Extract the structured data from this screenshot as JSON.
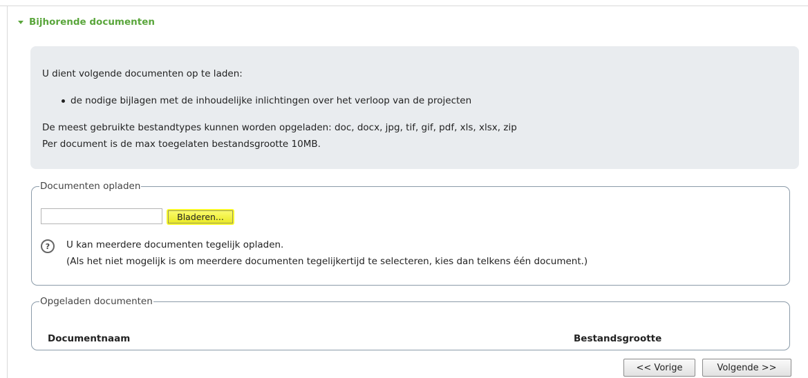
{
  "section": {
    "title": "Bijhorende documenten"
  },
  "info": {
    "intro": "U dient volgende documenten op te laden:",
    "items": [
      "de nodige bijlagen met de inhoudelijke inlichtingen over het verloop van de projecten"
    ],
    "types": "De meest gebruikte bestandtypes kunnen worden opgeladen: doc, docx, jpg, tif, gif, pdf, xls, xlsx, zip",
    "maxsize": "Per document is de max toegelaten bestandsgrootte 10MB."
  },
  "upload": {
    "legend": "Documenten opladen",
    "file_value": "",
    "browse_label": "Bladeren...",
    "help_icon": "?",
    "help_line1": "U kan meerdere documenten tegelijk opladen.",
    "help_line2": "(Als het niet mogelijk is om meerdere documenten tegelijkertijd te selecteren, kies dan telkens één document.)"
  },
  "uploaded": {
    "legend": "Opgeladen documenten",
    "columns": [
      "Documentnaam",
      "Bestandsgrootte"
    ]
  },
  "nav": {
    "prev_label": "<< Vorige",
    "next_label": "Volgende >>"
  },
  "colors": {
    "accent": "#5aa63c",
    "highlight": "#f7f72a",
    "info_bg": "#e9ecef",
    "border": "#8a9aa8"
  }
}
